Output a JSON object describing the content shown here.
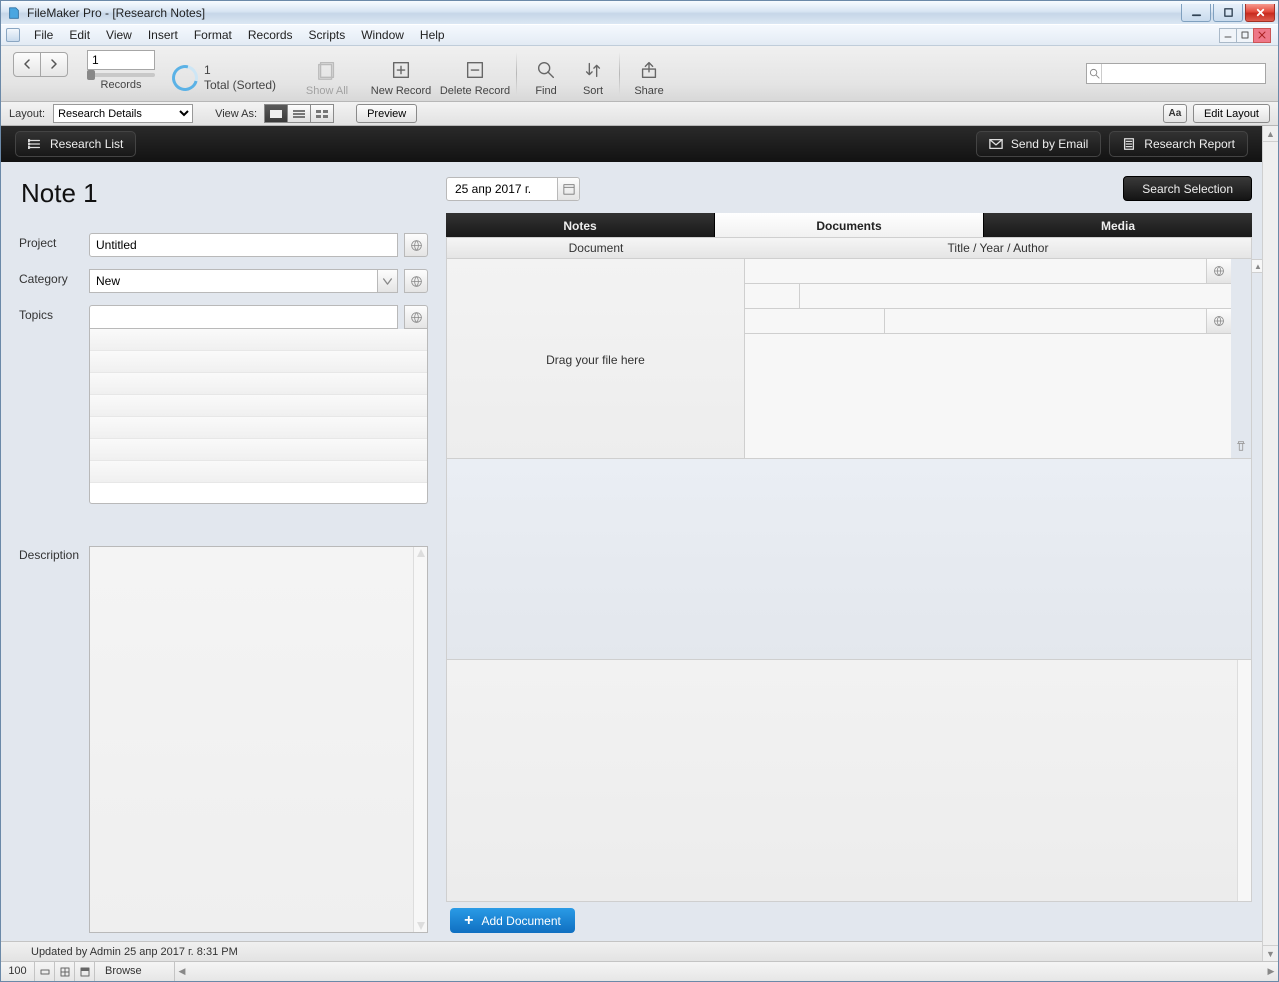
{
  "titlebar": {
    "title": "FileMaker Pro - [Research Notes]"
  },
  "menubar": {
    "items": [
      "File",
      "Edit",
      "View",
      "Insert",
      "Format",
      "Records",
      "Scripts",
      "Window",
      "Help"
    ]
  },
  "toolbar": {
    "record_number": "1",
    "records_label": "Records",
    "pie_count": "1",
    "pie_status": "Total (Sorted)",
    "show_all": "Show All",
    "new_record": "New Record",
    "delete_record": "Delete Record",
    "find": "Find",
    "sort": "Sort",
    "share": "Share",
    "search_placeholder": ""
  },
  "layoutbar": {
    "layout_label": "Layout:",
    "layout_value": "Research Details",
    "viewas_label": "View As:",
    "preview": "Preview",
    "aa": "Aa",
    "edit_layout": "Edit Layout"
  },
  "header": {
    "research_list": "Research List",
    "send_email": "Send by Email",
    "research_report": "Research Report"
  },
  "note": {
    "title": "Note 1",
    "date": "25 апр 2017 г.",
    "search_selection": "Search Selection",
    "tabs": [
      "Notes",
      "Documents",
      "Media"
    ],
    "doc_header_left": "Document",
    "doc_header_right": "Title / Year / Author",
    "dropzone": "Drag your file here",
    "add_document": "Add Document"
  },
  "fields": {
    "project_label": "Project",
    "project_value": "Untitled",
    "category_label": "Category",
    "category_value": "New",
    "topics_label": "Topics",
    "description_label": "Description"
  },
  "footer": {
    "updated": "Updated by Admin 25 апр 2017 г. 8:31 PM",
    "zoom": "100",
    "mode": "Browse"
  }
}
